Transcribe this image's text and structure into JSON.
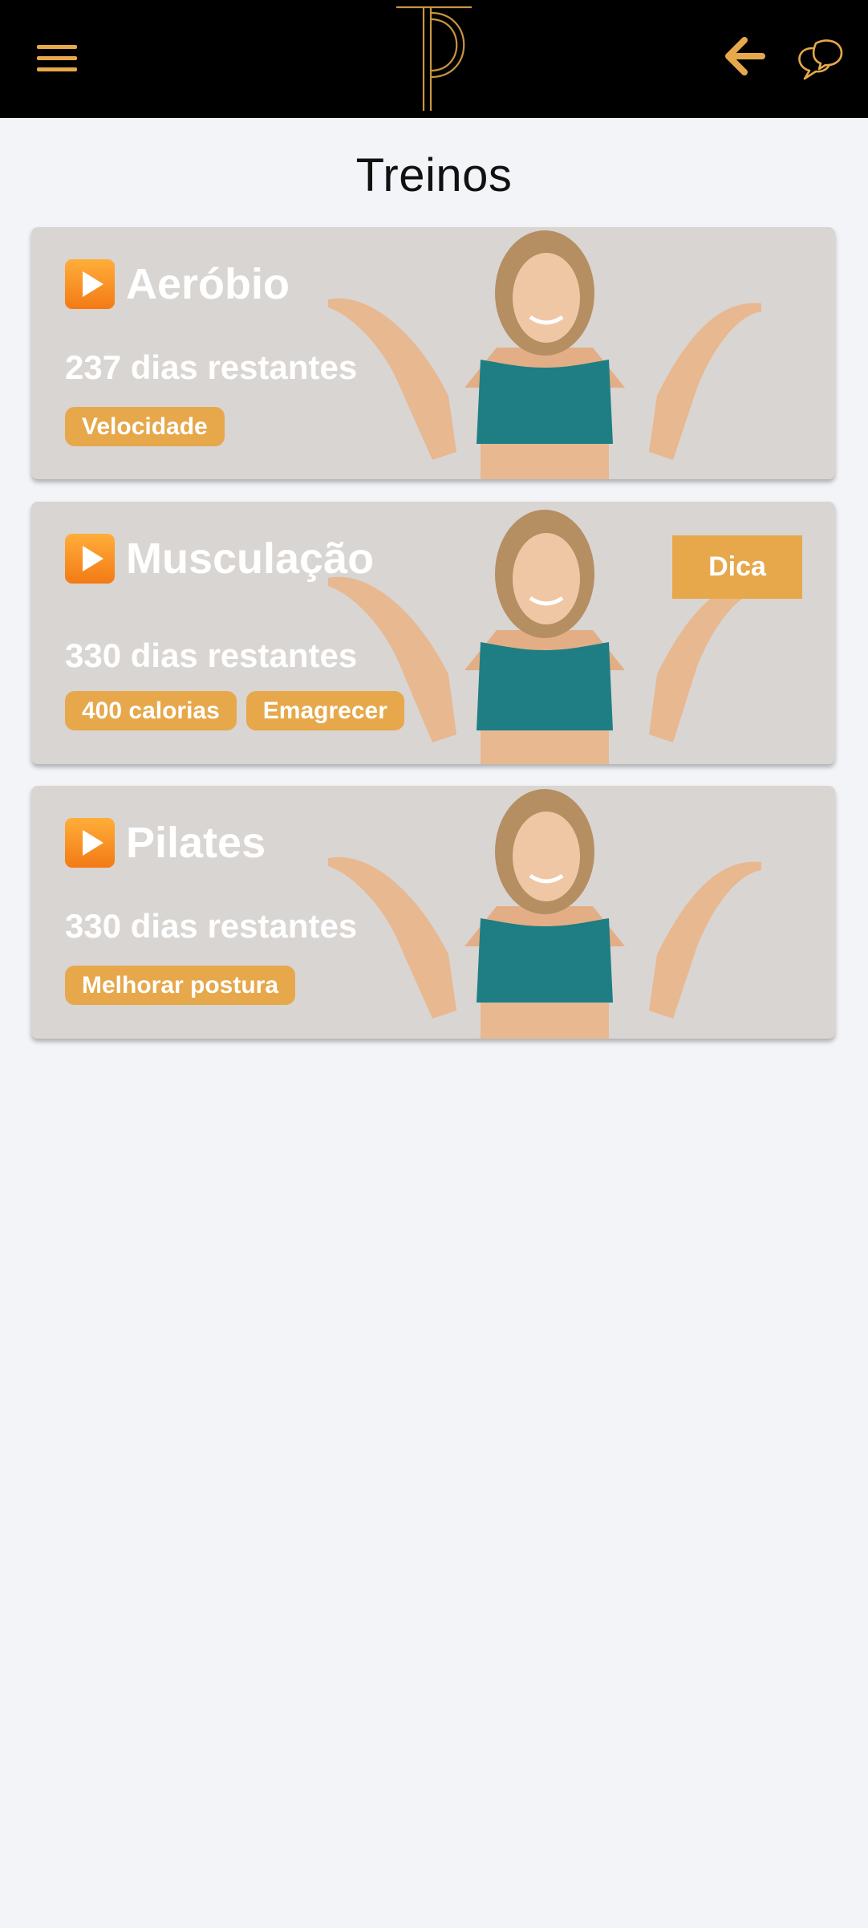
{
  "header": {
    "menu_icon": "hamburger-menu-icon",
    "logo": "TP-monogram-logo",
    "back_icon": "arrow-left-icon",
    "chat_icon": "chat-bubbles-icon",
    "accent_color": "#e6a84b",
    "background_color": "#000000"
  },
  "page": {
    "title": "Treinos",
    "background_color": "#f3f4f8"
  },
  "workouts": [
    {
      "title": "Aeróbio",
      "days_remaining": "237 dias restantes",
      "tags": [
        "Velocidade"
      ]
    },
    {
      "title": "Musculação",
      "days_remaining": "330 dias restantes",
      "tags": [
        "400 calorias",
        "Emagrecer"
      ],
      "tip_button": "Dica"
    },
    {
      "title": "Pilates",
      "days_remaining": "330 dias restantes",
      "tags": [
        "Melhorar postura"
      ]
    }
  ],
  "card_icon": "play-button-icon",
  "card_image": "trainer-photo-illustration"
}
